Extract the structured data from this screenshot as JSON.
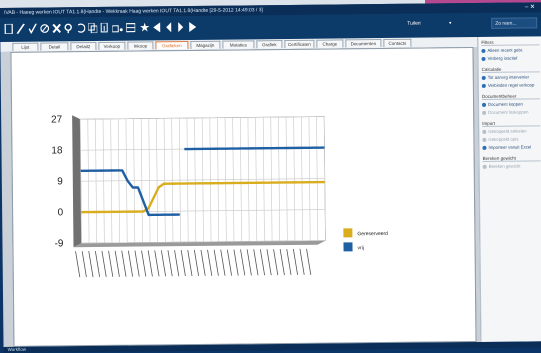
{
  "window": {
    "title": "IVAB - Haeeg werken IOUT TA1.1.8(Handte - Wekkraak Haag werken IOUT TA1.1.8(Handte    [29-5-2012 14:49:03 / 3]",
    "controls": "– ✕"
  },
  "toolbar": {
    "icons": [
      "new-icon",
      "edit-icon",
      "check-icon",
      "cancel-icon",
      "delete-icon",
      "search-icon",
      "undo-icon",
      "copy-icon",
      "export-icon",
      "print-icon",
      "star-icon",
      "first-icon",
      "prev-icon",
      "next-icon",
      "last-icon"
    ],
    "user_label": "Tuileri",
    "user_arrow": "▼",
    "search_placeholder": "Zo reen..."
  },
  "tabs": [
    {
      "label": "Lijst"
    },
    {
      "label": "Detail"
    },
    {
      "label": "Detail2"
    },
    {
      "label": "Verkoop"
    },
    {
      "label": "Inkoop"
    },
    {
      "label": "Grafieken",
      "active": true
    },
    {
      "label": "Magazijn"
    },
    {
      "label": "Mutaties"
    },
    {
      "label": "Grafiek"
    },
    {
      "label": "Certificaten"
    },
    {
      "label": "Charge"
    },
    {
      "label": "Documenten"
    },
    {
      "label": "Contacts"
    }
  ],
  "sidebar": {
    "filter_heading": "Filters",
    "filter_items": [
      "Alleen recent gebr.",
      "Verberg inactief"
    ],
    "calc_heading": "Calculatie",
    "calc_items": [
      "Tot aanvrg intervenier",
      "Verbinden regel verkoop"
    ],
    "doc_heading": "Documentbeheer",
    "doc_items": [
      "Document koppen",
      "Document loskoppen"
    ],
    "import_heading": "Import",
    "import_items": [
      "Gekoppeld artikelen",
      "Gekoppeld opts",
      "Importeer vanuit Excel"
    ],
    "rel_heading": "Bereken gewicht",
    "rel_items": [
      "Bereken gewicht"
    ]
  },
  "status": {
    "text": "Workflow"
  },
  "chart_data": {
    "type": "line",
    "yticks": [
      "27",
      "18",
      "9",
      "0",
      "-9"
    ],
    "ylim": [
      -9,
      27
    ],
    "x_count": 48,
    "series": [
      {
        "name": "Gereserveerd",
        "color": "#d9ad1e",
        "values": [
          0,
          0,
          0,
          0,
          0,
          0,
          0,
          0,
          0,
          0,
          0,
          0,
          0,
          1,
          4,
          7,
          8,
          8,
          8,
          8,
          8,
          8,
          8,
          8,
          8,
          8,
          8,
          8,
          8,
          8,
          8,
          8,
          8,
          8,
          8,
          8,
          8,
          8,
          8,
          8,
          8,
          8,
          8,
          8,
          8,
          8,
          8,
          8
        ]
      },
      {
        "name": "vrij",
        "color": "#1f5fa3",
        "values": [
          12,
          12,
          12,
          12,
          12,
          12,
          12,
          12,
          12,
          9,
          7,
          7,
          3,
          -1,
          -1,
          -1,
          -1,
          -1,
          -1,
          -1,
          null,
          null,
          null,
          null,
          null,
          null,
          null,
          null,
          null,
          null,
          null,
          null,
          null,
          null,
          null,
          null,
          null,
          null,
          null,
          null,
          null,
          null,
          null,
          null,
          null,
          null,
          null,
          null
        ],
        "values2_start": 20,
        "values2": [
          18,
          18,
          18,
          18,
          18,
          18,
          18,
          18,
          18,
          18,
          18,
          18,
          18,
          18,
          18,
          18,
          18,
          18,
          18,
          18,
          18,
          18,
          18,
          18,
          18,
          18,
          18,
          18
        ]
      }
    ],
    "legend_position": "right",
    "grid": true
  }
}
